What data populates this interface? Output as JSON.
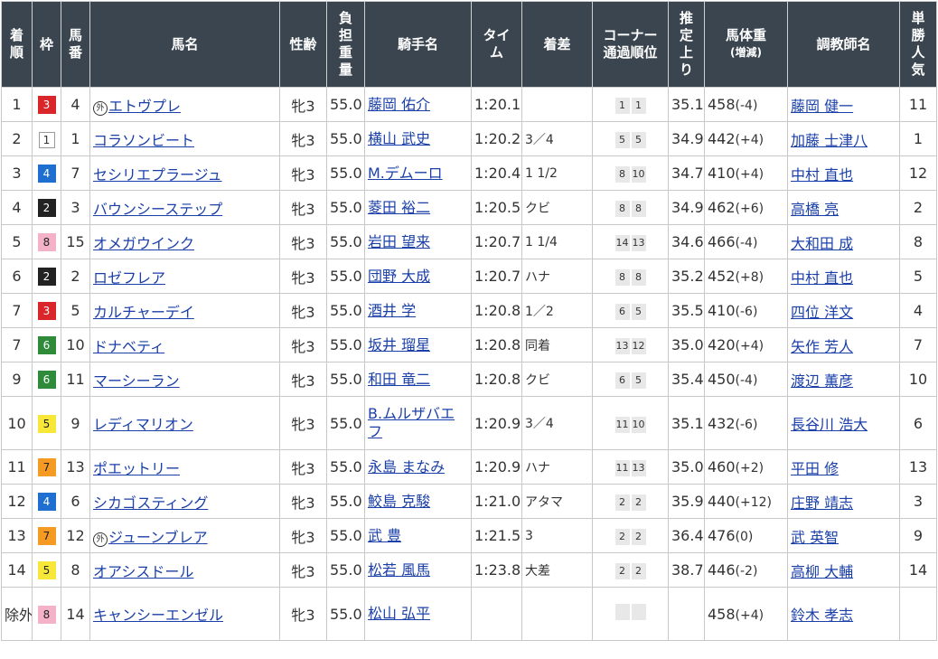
{
  "headers": {
    "rank": "着順",
    "waku": "枠",
    "umaban": "馬番",
    "horse": "馬名",
    "sexage": "性齢",
    "weight": "負担重量",
    "jockey": "騎手名",
    "time": "タイム",
    "margin": "着差",
    "corner": "コーナー通過順位",
    "last3f": "推定上り",
    "bodyweight": "馬体重",
    "bodyweight_sub": "(増減)",
    "trainer": "調教師名",
    "pop": "単勝人気"
  },
  "foreign_mark": "外",
  "rows": [
    {
      "rank": "1",
      "waku": "3",
      "umaban": "4",
      "foreign": true,
      "horse": "エトヴプレ",
      "sexage": "牝3",
      "weight": "55.0",
      "jockey": "藤岡 佑介",
      "time": "1:20.1",
      "margin": "",
      "c1": "1",
      "c2": "1",
      "last3f": "35.1",
      "bw": "458",
      "bwd": "(-4)",
      "trainer": "藤岡 健一",
      "pop": "11"
    },
    {
      "rank": "2",
      "waku": "1",
      "umaban": "1",
      "foreign": false,
      "horse": "コラソンビート",
      "sexage": "牝3",
      "weight": "55.0",
      "jockey": "横山 武史",
      "time": "1:20.2",
      "margin": "3／4",
      "c1": "5",
      "c2": "5",
      "last3f": "34.9",
      "bw": "442",
      "bwd": "(+4)",
      "trainer": "加藤 士津八",
      "pop": "1"
    },
    {
      "rank": "3",
      "waku": "4",
      "umaban": "7",
      "foreign": false,
      "horse": "セシリエプラージュ",
      "sexage": "牝3",
      "weight": "55.0",
      "jockey": "M.デムーロ",
      "time": "1:20.4",
      "margin": "1 1/2",
      "c1": "8",
      "c2": "10",
      "last3f": "34.7",
      "bw": "410",
      "bwd": "(+4)",
      "trainer": "中村 直也",
      "pop": "12"
    },
    {
      "rank": "4",
      "waku": "2",
      "umaban": "3",
      "foreign": false,
      "horse": "バウンシーステップ",
      "sexage": "牝3",
      "weight": "55.0",
      "jockey": "菱田 裕二",
      "time": "1:20.5",
      "margin": "クビ",
      "c1": "8",
      "c2": "8",
      "last3f": "34.9",
      "bw": "462",
      "bwd": "(+6)",
      "trainer": "高橋 亮",
      "pop": "2"
    },
    {
      "rank": "5",
      "waku": "8",
      "umaban": "15",
      "foreign": false,
      "horse": "オメガウインク",
      "sexage": "牝3",
      "weight": "55.0",
      "jockey": "岩田 望来",
      "time": "1:20.7",
      "margin": "1 1/4",
      "c1": "14",
      "c2": "13",
      "last3f": "34.6",
      "bw": "466",
      "bwd": "(-4)",
      "trainer": "大和田 成",
      "pop": "8"
    },
    {
      "rank": "6",
      "waku": "2",
      "umaban": "2",
      "foreign": false,
      "horse": "ロゼフレア",
      "sexage": "牝3",
      "weight": "55.0",
      "jockey": "団野 大成",
      "time": "1:20.7",
      "margin": "ハナ",
      "c1": "8",
      "c2": "8",
      "last3f": "35.2",
      "bw": "452",
      "bwd": "(+8)",
      "trainer": "中村 直也",
      "pop": "5"
    },
    {
      "rank": "7",
      "waku": "3",
      "umaban": "5",
      "foreign": false,
      "horse": "カルチャーデイ",
      "sexage": "牝3",
      "weight": "55.0",
      "jockey": "酒井 学",
      "time": "1:20.8",
      "margin": "1／2",
      "c1": "6",
      "c2": "5",
      "last3f": "35.5",
      "bw": "410",
      "bwd": "(-6)",
      "trainer": "四位 洋文",
      "pop": "4"
    },
    {
      "rank": "7",
      "waku": "6",
      "umaban": "10",
      "foreign": false,
      "horse": "ドナベティ",
      "sexage": "牝3",
      "weight": "55.0",
      "jockey": "坂井 瑠星",
      "time": "1:20.8",
      "margin": "同着",
      "c1": "13",
      "c2": "12",
      "last3f": "35.0",
      "bw": "420",
      "bwd": "(+4)",
      "trainer": "矢作 芳人",
      "pop": "7"
    },
    {
      "rank": "9",
      "waku": "6",
      "umaban": "11",
      "foreign": false,
      "horse": "マーシーラン",
      "sexage": "牝3",
      "weight": "55.0",
      "jockey": "和田 竜二",
      "time": "1:20.8",
      "margin": "クビ",
      "c1": "6",
      "c2": "5",
      "last3f": "35.4",
      "bw": "450",
      "bwd": "(-4)",
      "trainer": "渡辺 薫彦",
      "pop": "10"
    },
    {
      "rank": "10",
      "waku": "5",
      "umaban": "9",
      "foreign": false,
      "horse": "レディマリオン",
      "sexage": "牝3",
      "weight": "55.0",
      "jockey": "B.ムルザバエフ",
      "time": "1:20.9",
      "margin": "3／4",
      "c1": "11",
      "c2": "10",
      "last3f": "35.1",
      "bw": "432",
      "bwd": "(-6)",
      "trainer": "長谷川 浩大",
      "pop": "6",
      "tall": true
    },
    {
      "rank": "11",
      "waku": "7",
      "umaban": "13",
      "foreign": false,
      "horse": "ポエットリー",
      "sexage": "牝3",
      "weight": "55.0",
      "jockey": "永島 まなみ",
      "time": "1:20.9",
      "margin": "ハナ",
      "c1": "11",
      "c2": "13",
      "last3f": "35.0",
      "bw": "460",
      "bwd": "(+2)",
      "trainer": "平田 修",
      "pop": "13"
    },
    {
      "rank": "12",
      "waku": "4",
      "umaban": "6",
      "foreign": false,
      "horse": "シカゴスティング",
      "sexage": "牝3",
      "weight": "55.0",
      "jockey": "鮫島 克駿",
      "time": "1:21.0",
      "margin": "アタマ",
      "c1": "2",
      "c2": "2",
      "last3f": "35.9",
      "bw": "440",
      "bwd": "(+12)",
      "trainer": "庄野 靖志",
      "pop": "3"
    },
    {
      "rank": "13",
      "waku": "7",
      "umaban": "12",
      "foreign": true,
      "horse": "ジューンブレア",
      "sexage": "牝3",
      "weight": "55.0",
      "jockey": "武 豊",
      "time": "1:21.5",
      "margin": "3",
      "c1": "2",
      "c2": "2",
      "last3f": "36.4",
      "bw": "476",
      "bwd": "(0)",
      "trainer": "武 英智",
      "pop": "9"
    },
    {
      "rank": "14",
      "waku": "5",
      "umaban": "8",
      "foreign": false,
      "horse": "オアシスドール",
      "sexage": "牝3",
      "weight": "55.0",
      "jockey": "松若 風馬",
      "time": "1:23.8",
      "margin": "大差",
      "c1": "2",
      "c2": "2",
      "last3f": "38.7",
      "bw": "446",
      "bwd": "(-2)",
      "trainer": "高柳 大輔",
      "pop": "14"
    },
    {
      "rank": "除外",
      "waku": "8",
      "umaban": "14",
      "foreign": false,
      "horse": "キャンシーエンゼル",
      "sexage": "牝3",
      "weight": "55.0",
      "jockey": "松山 弘平",
      "time": "",
      "margin": "",
      "c1": "",
      "c2": "",
      "last3f": "",
      "bw": "458",
      "bwd": "(+4)",
      "trainer": "鈴木 孝志",
      "pop": "",
      "tall": true
    }
  ]
}
